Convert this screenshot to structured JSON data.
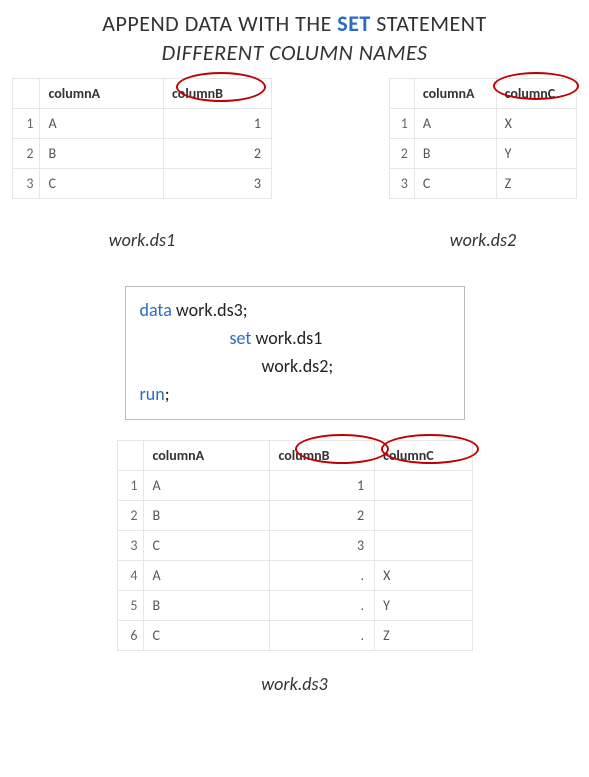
{
  "title": {
    "line1_pre": "APPEND DATA WITH THE ",
    "line1_emph": "SET",
    "line1_post": " STATEMENT",
    "line2": "DIFFERENT COLUMN NAMES"
  },
  "ds1": {
    "label": "work.ds1",
    "headers": {
      "a": "columnA",
      "b": "columnB"
    },
    "rows": [
      {
        "n": "1",
        "a": "A",
        "b": "1"
      },
      {
        "n": "2",
        "a": "B",
        "b": "2"
      },
      {
        "n": "3",
        "a": "C",
        "b": "3"
      }
    ]
  },
  "ds2": {
    "label": "work.ds2",
    "headers": {
      "a": "columnA",
      "c": "columnC"
    },
    "rows": [
      {
        "n": "1",
        "a": "A",
        "c": "X"
      },
      {
        "n": "2",
        "a": "B",
        "c": "Y"
      },
      {
        "n": "3",
        "a": "C",
        "c": "Z"
      }
    ]
  },
  "code": {
    "kw_data": "data",
    "data_arg": " work.ds3;",
    "kw_set": "set",
    "set_arg1": " work.ds1",
    "set_arg2": "work.ds2;",
    "kw_run": "run",
    "run_suffix": ";"
  },
  "ds3": {
    "label": "work.ds3",
    "headers": {
      "a": "columnA",
      "b": "columnB",
      "c": "columnC"
    },
    "rows": [
      {
        "n": "1",
        "a": "A",
        "b": "1",
        "c": ""
      },
      {
        "n": "2",
        "a": "B",
        "b": "2",
        "c": ""
      },
      {
        "n": "3",
        "a": "C",
        "b": "3",
        "c": ""
      },
      {
        "n": "4",
        "a": "A",
        "b": ".",
        "c": "X"
      },
      {
        "n": "5",
        "a": "B",
        "b": ".",
        "c": "Y"
      },
      {
        "n": "6",
        "a": "C",
        "b": ".",
        "c": "Z"
      }
    ]
  }
}
